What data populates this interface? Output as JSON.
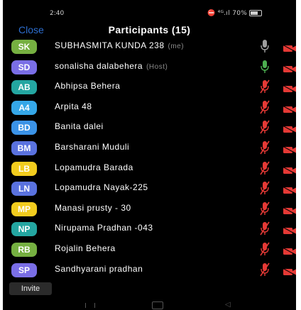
{
  "status_bar": {
    "time": "2:40",
    "indicators": "⛔ ⁴ᴳ.ıl 70%"
  },
  "header": {
    "close_label": "Close",
    "title": "Participants (15)"
  },
  "participants": [
    {
      "initials": "SK",
      "name": "SUBHASMITA KUNDA 238",
      "tag": "(me)",
      "color": "#76b041",
      "mic": "off-grey"
    },
    {
      "initials": "SD",
      "name": "sonalisha dalabehera",
      "tag": "(Host)",
      "color": "#7a6ee6",
      "mic": "on"
    },
    {
      "initials": "AB",
      "name": "Abhipsa Behera",
      "tag": "",
      "color": "#24a6a1",
      "mic": "muted"
    },
    {
      "initials": "A4",
      "name": "Arpita 48",
      "tag": "",
      "color": "#35a7e8",
      "mic": "muted"
    },
    {
      "initials": "BD",
      "name": "Banita dalei",
      "tag": "",
      "color": "#3b93e7",
      "mic": "muted"
    },
    {
      "initials": "BM",
      "name": "Barsharani Muduli",
      "tag": "",
      "color": "#5a72df",
      "mic": "muted"
    },
    {
      "initials": "LB",
      "name": "Lopamudra Barada",
      "tag": "",
      "color": "#f2cc1e",
      "mic": "muted"
    },
    {
      "initials": "LN",
      "name": "Lopamudra Nayak-225",
      "tag": "",
      "color": "#5a72df",
      "mic": "muted"
    },
    {
      "initials": "MP",
      "name": "Manasi prusty - 30",
      "tag": "",
      "color": "#f2cc1e",
      "mic": "muted"
    },
    {
      "initials": "NP",
      "name": "Nirupama Pradhan -043",
      "tag": "",
      "color": "#24a6a1",
      "mic": "muted"
    },
    {
      "initials": "RB",
      "name": "Rojalin Behera",
      "tag": "",
      "color": "#76b041",
      "mic": "muted"
    },
    {
      "initials": "SP",
      "name": "Sandhyarani pradhan",
      "tag": "",
      "color": "#7a6ee6",
      "mic": "muted"
    }
  ],
  "footer": {
    "invite_label": "Invite"
  },
  "colors": {
    "accent": "#2d6ecf",
    "mic_off": "#e53935",
    "mic_on": "#4caf50"
  }
}
